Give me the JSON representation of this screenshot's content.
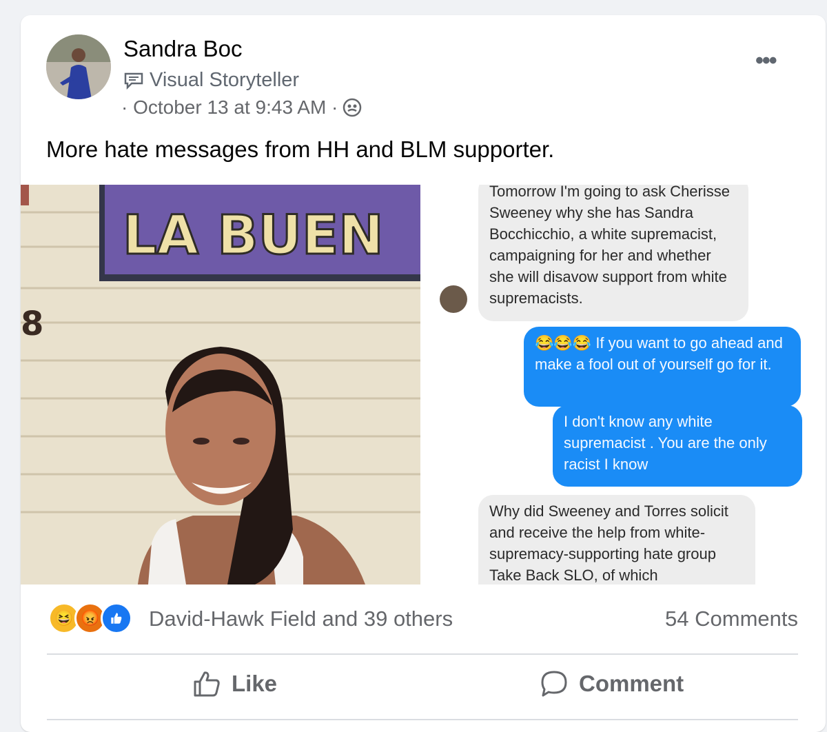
{
  "post": {
    "author": "Sandra Boc",
    "role": "Visual Storyteller",
    "timestamp": "· October 13 at 9:43 AM ·",
    "text": "More hate messages from HH and BLM supporter."
  },
  "photo": {
    "sign_text": "LA BUEN",
    "house_number": "8"
  },
  "chat": {
    "incoming_1": "Tomorrow I'm going to ask Cherisse Sweeney why she has Sandra Bocchicchio, a white supremacist, campaigning for her and whether she will disavow support from white supremacists.",
    "outgoing_1_emoji": "😂😂😂",
    "outgoing_1": "If you want to go ahead and make a fool out of yourself go for it.",
    "outgoing_2": "I don't know any white supremacist . You are the only racist I know",
    "incoming_2": "Why did Sweeney and Torres solicit and receive the help from white-supremacy-supporting hate group Take Back SLO, of which"
  },
  "reactions": {
    "names": "David-Hawk Field and 39 others",
    "comments": "54 Comments",
    "icons": [
      "haha-icon",
      "angry-icon",
      "like-icon"
    ]
  },
  "actions": {
    "like": "Like",
    "comment": "Comment"
  },
  "colors": {
    "outgoing_bubble": "#1a8cf6",
    "incoming_bubble": "#ededed",
    "sign_purple": "#6e5aa8"
  }
}
